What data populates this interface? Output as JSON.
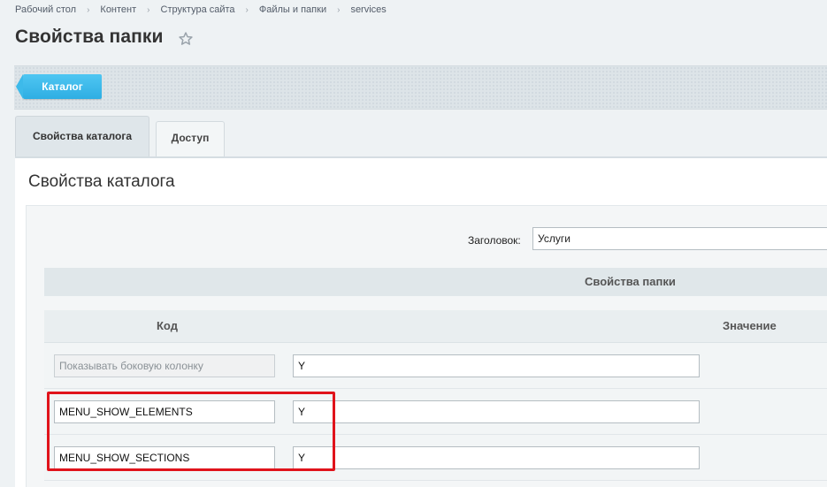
{
  "breadcrumb": {
    "items": [
      "Рабочий стол",
      "Контент",
      "Структура сайта",
      "Файлы и папки",
      "services"
    ]
  },
  "page": {
    "title": "Свойства папки",
    "favorite_icon": "star-outline-icon"
  },
  "toolbar": {
    "catalog_button_label": "Каталог"
  },
  "tabs": [
    {
      "label": "Свойства каталога",
      "active": true
    },
    {
      "label": "Доступ",
      "active": false
    }
  ],
  "section": {
    "heading": "Свойства каталога",
    "header_field": {
      "label": "Заголовок:",
      "value": "Услуги"
    },
    "properties_title": "Свойства папки",
    "columns": {
      "code": "Код",
      "value": "Значение"
    },
    "rows": [
      {
        "code": "",
        "code_placeholder": "Показывать боковую колонку",
        "value": "Y"
      },
      {
        "code": "MENU_SHOW_ELEMENTS",
        "code_placeholder": "",
        "value": "Y"
      },
      {
        "code": "MENU_SHOW_SECTIONS",
        "code_placeholder": "",
        "value": "Y"
      }
    ]
  },
  "colors": {
    "accent_button": "#2eaee3",
    "highlight": "#e0131b"
  }
}
